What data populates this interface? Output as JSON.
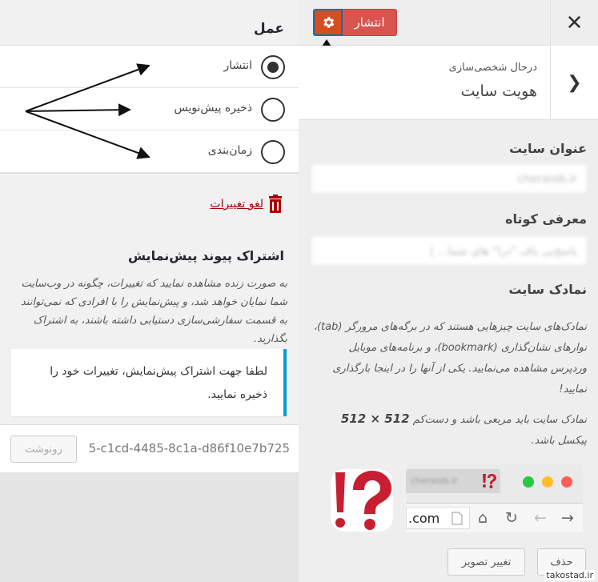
{
  "left_panel": {
    "section_title": "عمل",
    "options": [
      {
        "label": "انتشار",
        "checked": true
      },
      {
        "label": "ذخیره پیش‌نویس",
        "checked": false
      },
      {
        "label": "زمان‌بندی",
        "checked": false
      }
    ],
    "discard_label": "لغو تغییرات",
    "share_title": "اشتراک پیوند پیش‌نمایش",
    "share_description": "به صورت زنده مشاهده نمایید که تغییرات، چگونه در وب‌سایت شما نمایان خواهد شد، و پیش‌نمایش را با افرادی که نمی‌توانند به قسمت سفارشی‌سازی دستیابی داشته باشند، به اشتراک بگذارید.",
    "notice": "لطفا جهت اشتراک پیش‌نمایش، تغییرات خود را ذخیره نمایید.",
    "preview_link": "5-c1cd-4485-8c1a-d86f10e7b725",
    "copy_label": "رونوشت"
  },
  "header": {
    "publish_label": "انتشار",
    "close_icon": "close-icon",
    "settings_icon": "gear-icon"
  },
  "section": {
    "customizing_label": "درحال شخصی‌سازی",
    "title": "هویت سایت",
    "back_icon": "chevron-right-icon"
  },
  "fields": {
    "site_title_label": "عنوان سایت",
    "site_title_value": "cheraiob.ir",
    "tagline_label": "معرفی کوتاه",
    "tagline_value": "یاسخ‌یی یاف \"درا\" های شما... |",
    "site_icon_label": "نمادک سایت",
    "site_icon_description": "نمادک‌های سایت چیزهایی هستند که در برگه‌های مرورگر (tab)، نوارهای نشان‌گذاری (bookmark)، و برنامه‌های موبایل وردپرس مشاهده می‌نمایید. یکی از آنها را در اینجا بارگذاری نمایید!",
    "site_icon_size_prefix": "نمادک سایت باید مربعی باشد و دست‌کم",
    "site_icon_size_value": "512 × 512",
    "site_icon_size_suffix": "پیکسل باشد."
  },
  "preview": {
    "tab_title": "cheraiob.ir",
    "url_text": ".com"
  },
  "buttons": {
    "remove_label": "حذف",
    "change_image_label": "تغییر تصویر"
  },
  "watermark": "takostad.ir",
  "colors": {
    "publish": "#d9534f",
    "settings": "#d54e21",
    "focus": "#0073aa",
    "notice_border": "#00a0d2",
    "discard": "#aa0000"
  }
}
